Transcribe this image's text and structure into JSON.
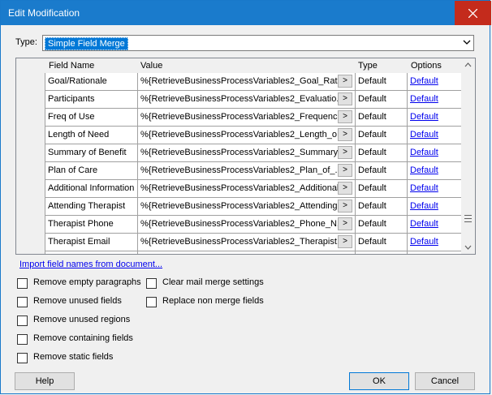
{
  "window": {
    "title": "Edit Modification",
    "close_glyph": "✕"
  },
  "type_field": {
    "label": "Type:",
    "value": "Simple Field Merge"
  },
  "grid": {
    "columns": [
      "Field Name",
      "Value",
      "Type",
      "Options"
    ],
    "rows": [
      {
        "name": "Goal/Rationale",
        "value": "%{RetrieveBusinessProcessVariables2_Goal_Rati...",
        "type": "Default",
        "option": "Default"
      },
      {
        "name": "Participants",
        "value": "%{RetrieveBusinessProcessVariables2_Evaluatio...",
        "type": "Default",
        "option": "Default"
      },
      {
        "name": "Freq of Use",
        "value": "%{RetrieveBusinessProcessVariables2_Frequenc...",
        "type": "Default",
        "option": "Default"
      },
      {
        "name": "Length of Need",
        "value": "%{RetrieveBusinessProcessVariables2_Length_o...",
        "type": "Default",
        "option": "Default"
      },
      {
        "name": "Summary of Benefit",
        "value": "%{RetrieveBusinessProcessVariables2_Summary...",
        "type": "Default",
        "option": "Default"
      },
      {
        "name": "Plan of Care",
        "value": "%{RetrieveBusinessProcessVariables2_Plan_of_...",
        "type": "Default",
        "option": "Default"
      },
      {
        "name": "Additional Information",
        "value": "%{RetrieveBusinessProcessVariables2_Additional...",
        "type": "Default",
        "option": "Default"
      },
      {
        "name": "Attending Therapist",
        "value": "%{RetrieveBusinessProcessVariables2_Attending...",
        "type": "Default",
        "option": "Default"
      },
      {
        "name": "Therapist Phone",
        "value": "%{RetrieveBusinessProcessVariables2_Phone_N...",
        "type": "Default",
        "option": "Default"
      },
      {
        "name": "Therapist Email",
        "value": "%{RetrieveBusinessProcessVariables2_Therapist...",
        "type": "Default",
        "option": "Default"
      }
    ],
    "ellipsis_label": ">"
  },
  "import_link": "Import field names from document...",
  "checkboxes_left": [
    "Remove empty paragraphs",
    "Remove unused fields",
    "Remove unused regions",
    "Remove containing fields",
    "Remove static fields"
  ],
  "checkboxes_right": [
    "Clear mail merge settings",
    "Replace non merge fields"
  ],
  "buttons": {
    "help": "Help",
    "ok": "OK",
    "cancel": "Cancel"
  },
  "colors": {
    "titlebar": "#1a7bcc",
    "close_hover": "#c42b1c",
    "selection": "#0078d7",
    "link": "#0000ee"
  },
  "icons": [
    "close-icon",
    "chevron-down-icon",
    "scroll-up-icon",
    "scroll-down-icon"
  ]
}
